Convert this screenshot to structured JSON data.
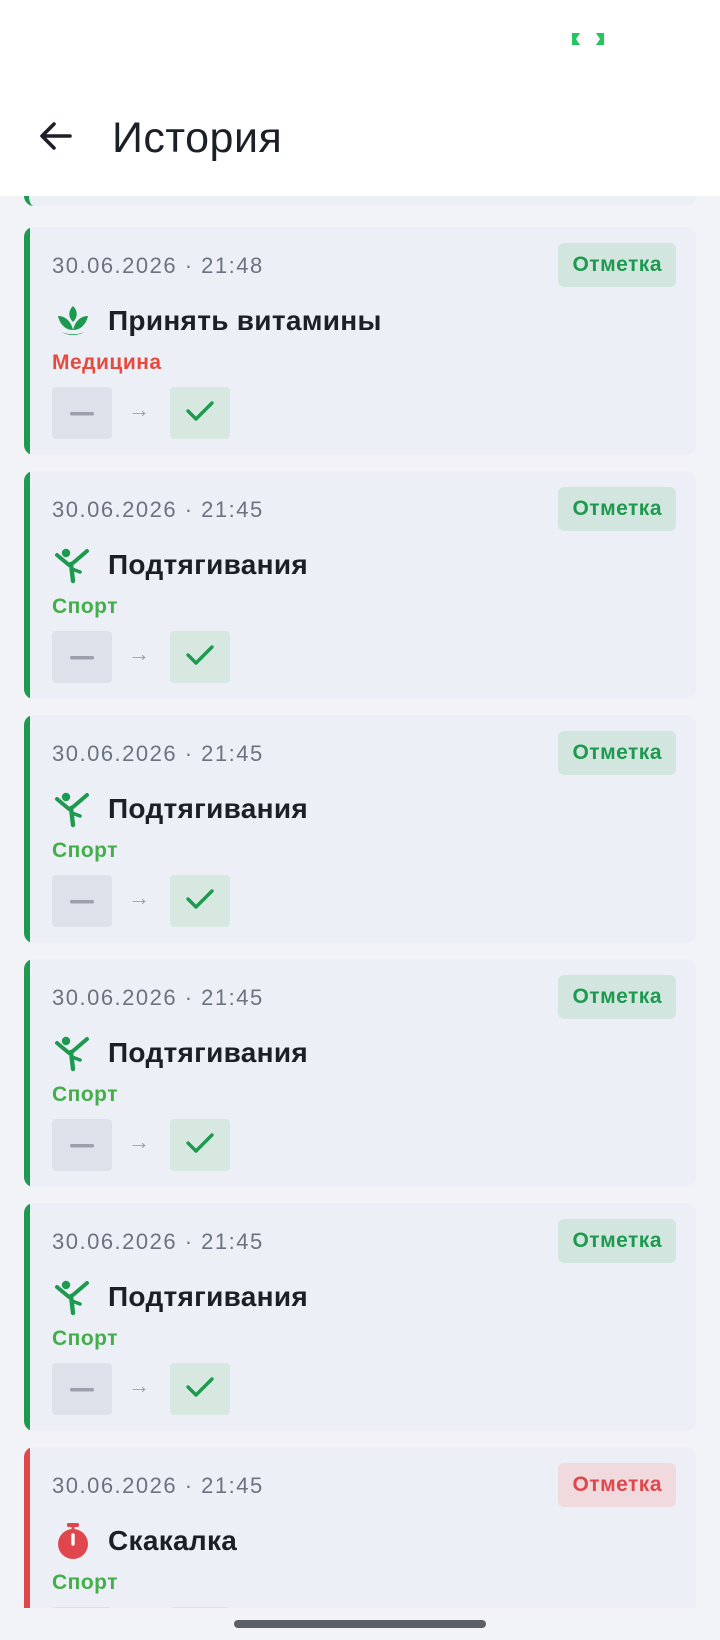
{
  "app": {
    "title": "История",
    "colors": {
      "accent_green": "#1e9a50",
      "accent_red": "#e0474c",
      "category_sport": "#43ae4a",
      "category_medicine": "#e8493f",
      "badge_green_bg": "#d2e6df",
      "badge_red_bg": "#f1dadd"
    }
  },
  "status_bar": {
    "indicator_icon": "screen-record-icon"
  },
  "header": {
    "back_icon": "arrow-left-icon",
    "title": "История"
  },
  "history": [
    {
      "timestamp": "30.06.2026 · 21:48",
      "badge": "Отметка",
      "status": "success",
      "icon": "lotus-icon",
      "title": "Принять витамины",
      "category": "Медицина",
      "category_kind": "medicine",
      "from_icon": "dash-icon",
      "arrow": "→",
      "to_icon": "check-icon"
    },
    {
      "timestamp": "30.06.2026 · 21:45",
      "badge": "Отметка",
      "status": "success",
      "icon": "athlete-icon",
      "title": "Подтягивания",
      "category": "Спорт",
      "category_kind": "sport",
      "from_icon": "dash-icon",
      "arrow": "→",
      "to_icon": "check-icon"
    },
    {
      "timestamp": "30.06.2026 · 21:45",
      "badge": "Отметка",
      "status": "success",
      "icon": "athlete-icon",
      "title": "Подтягивания",
      "category": "Спорт",
      "category_kind": "sport",
      "from_icon": "dash-icon",
      "arrow": "→",
      "to_icon": "check-icon"
    },
    {
      "timestamp": "30.06.2026 · 21:45",
      "badge": "Отметка",
      "status": "success",
      "icon": "athlete-icon",
      "title": "Подтягивания",
      "category": "Спорт",
      "category_kind": "sport",
      "from_icon": "dash-icon",
      "arrow": "→",
      "to_icon": "check-icon"
    },
    {
      "timestamp": "30.06.2026 · 21:45",
      "badge": "Отметка",
      "status": "success",
      "icon": "athlete-icon",
      "title": "Подтягивания",
      "category": "Спорт",
      "category_kind": "sport",
      "from_icon": "dash-icon",
      "arrow": "→",
      "to_icon": "check-icon"
    },
    {
      "timestamp": "30.06.2026 · 21:45",
      "badge": "Отметка",
      "status": "failure",
      "icon": "stopwatch-icon",
      "title": "Скакалка",
      "category": "Спорт",
      "category_kind": "sport",
      "from_icon": "dash-icon",
      "arrow": "→",
      "to_icon": "check-icon"
    }
  ]
}
